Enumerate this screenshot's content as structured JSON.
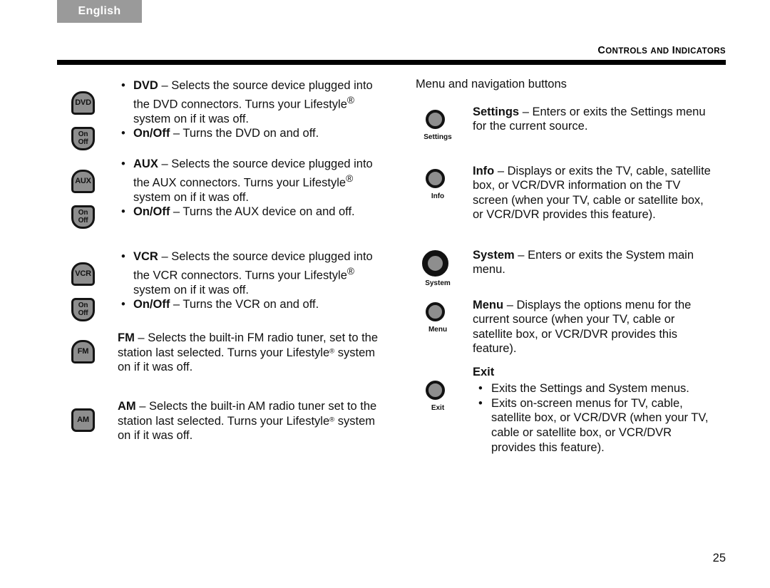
{
  "header": {
    "language_tab": "English",
    "running_head_words": [
      "Controls",
      "and",
      "Indicators"
    ],
    "running_head_full": "CONTROLS AND INDICATORS"
  },
  "page_number": "25",
  "left_column": {
    "groups": [
      {
        "icons": [
          {
            "glyph": "DVD",
            "shape": "dome",
            "name": "dvd-source-button-icon"
          },
          {
            "glyph_line1": "On",
            "glyph_line2": "Off",
            "shape": "shield",
            "name": "dvd-onoff-button-icon"
          }
        ],
        "bullets": [
          {
            "term": "DVD",
            "dash": "–",
            "text": "Selects the source device plugged into the DVD connectors. Turns your Lifestyle",
            "trademark": "®",
            "text_after": " system on if it was off."
          },
          {
            "term": "On/Off",
            "dash": "–",
            "text": "Turns the DVD on and off.",
            "trademark": "",
            "text_after": ""
          }
        ]
      },
      {
        "icons": [
          {
            "glyph": "AUX",
            "shape": "dome",
            "name": "aux-source-button-icon"
          },
          {
            "glyph_line1": "On",
            "glyph_line2": "Off",
            "shape": "shield",
            "name": "aux-onoff-button-icon"
          }
        ],
        "bullets": [
          {
            "term": "AUX",
            "dash": "–",
            "text": "Selects the source device plugged into the AUX connectors. Turns your Lifestyle",
            "trademark": "®",
            "text_after": " system on if it was off."
          },
          {
            "term": "On/Off",
            "dash": "–",
            "text": "Turns the AUX device on and off.",
            "trademark": "",
            "text_after": ""
          }
        ]
      },
      {
        "icons": [
          {
            "glyph": "VCR",
            "shape": "dome",
            "name": "vcr-source-button-icon"
          },
          {
            "glyph_line1": "On",
            "glyph_line2": "Off",
            "shape": "shield",
            "name": "vcr-onoff-button-icon"
          }
        ],
        "bullets": [
          {
            "term": "VCR",
            "dash": "–",
            "text": "Selects the source device plugged into the VCR connectors. Turns your Lifestyle",
            "trademark": "®",
            "text_after": " system on if it was off."
          },
          {
            "term": "On/Off",
            "dash": "–",
            "text": "Turns the VCR on and off.",
            "trademark": "",
            "text_after": ""
          }
        ]
      }
    ],
    "paragraphs": [
      {
        "icon": {
          "glyph": "FM",
          "shape": "dome",
          "name": "fm-source-button-icon"
        },
        "term": "FM",
        "dash": "–",
        "text": "Selects the built-in FM radio tuner, set to the station last selected. Turns your Lifestyle",
        "trademark": "®",
        "text_after": " system on if it was off."
      },
      {
        "icon": {
          "glyph": "AM",
          "shape": "rounded",
          "name": "am-source-button-icon"
        },
        "term": "AM",
        "dash": "–",
        "text": "Selects the built-in AM radio tuner set to the station last selected. Turns your Lifestyle",
        "trademark": "®",
        "text_after": " system on if it was off."
      }
    ]
  },
  "right_column": {
    "section_title": "Menu and navigation buttons",
    "entries": [
      {
        "icon_label": "Settings",
        "icon_size": "small",
        "icon_name": "settings-button-icon",
        "term": "Settings",
        "dash": "–",
        "text": "Enters or exits the Settings menu for the current source."
      },
      {
        "icon_label": "Info",
        "icon_size": "small",
        "icon_name": "info-button-icon",
        "term": "Info",
        "dash": "–",
        "text": "Displays or exits the TV, cable, satellite box, or VCR/DVR information on the TV screen (when your TV, cable or satellite box, or VCR/DVR provides this feature)."
      },
      {
        "icon_label": "System",
        "icon_size": "large",
        "icon_name": "system-button-icon",
        "term": "System",
        "dash": "–",
        "text": "Enters or exits the System main menu."
      },
      {
        "icon_label": "Menu",
        "icon_size": "small",
        "icon_name": "menu-button-icon",
        "term": "Menu",
        "dash": "–",
        "text": "Displays the options menu for the current source (when your TV, cable or satellite box, or VCR/DVR provides this feature)."
      }
    ],
    "exit_entry": {
      "icon_label": "Exit",
      "icon_name": "exit-button-icon",
      "heading": "Exit",
      "bullets": [
        "Exits the Settings and System menus.",
        "Exits on-screen menus for TV, cable, satellite box, or VCR/DVR (when your TV, cable or satellite box, or VCR/DVR provides this feature)."
      ]
    }
  },
  "colors": {
    "tab_background": "#9a9a9a",
    "rule": "#000000",
    "icon_fill": "#8e8e8e",
    "icon_outline": "#121212",
    "text": "#111111"
  }
}
